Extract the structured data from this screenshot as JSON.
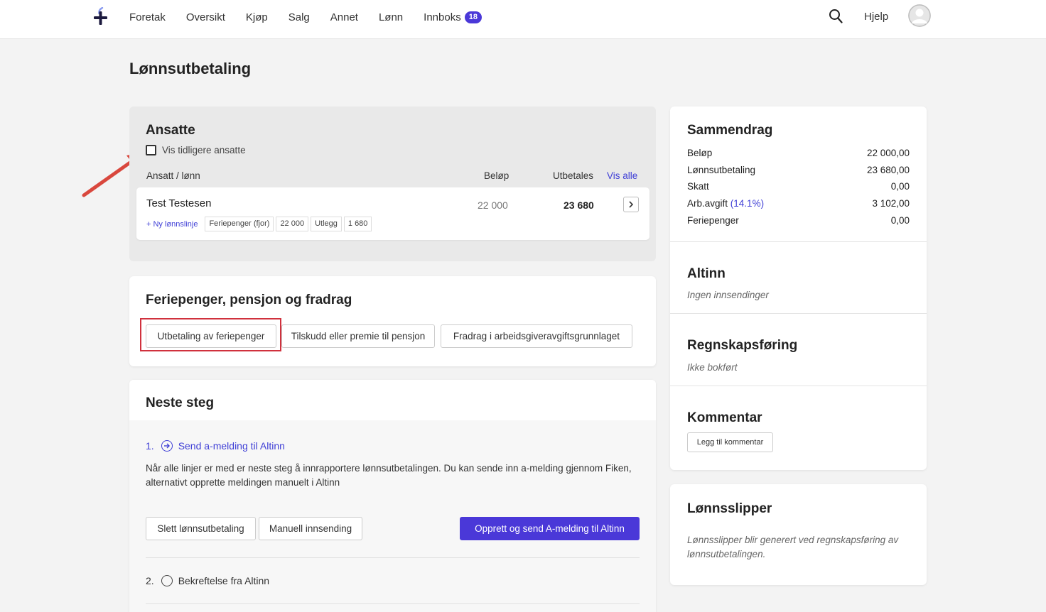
{
  "nav": {
    "items": [
      "Foretak",
      "Oversikt",
      "Kjøp",
      "Salg",
      "Annet",
      "Lønn",
      "Innboks"
    ],
    "inbox_badge": "18",
    "help": "Hjelp"
  },
  "page_title": "Lønnsutbetaling",
  "ansatte": {
    "title": "Ansatte",
    "checkbox_label": "Vis tidligere ansatte",
    "col_employee": "Ansatt / lønn",
    "col_amount": "Beløp",
    "col_paid": "Utbetales",
    "show_all": "Vis alle",
    "employee": {
      "name": "Test Testesen",
      "amount": "22 000",
      "paid": "23 680",
      "new_line": "+ Ny lønnslinje",
      "tags": [
        "Feriepenger (fjor)",
        "22 000",
        "Utlegg",
        "1 680"
      ]
    }
  },
  "ferie": {
    "title": "Feriepenger, pensjon og fradrag",
    "btn1": "Utbetaling av feriepenger",
    "btn2": "Tilskudd eller premie til pensjon",
    "btn3": "Fradrag i arbeidsgiveravgiftsgrunnlaget"
  },
  "neste": {
    "title": "Neste steg",
    "step1_num": "1.",
    "step1_label": "Send a-melding til Altinn",
    "step1_desc": "Når alle linjer er med er neste steg å innrapportere lønnsutbetalingen. Du kan sende inn a-melding gjennom Fiken, alternativt opprette meldingen manuelt i Altinn",
    "btn_delete": "Slett lønnsutbetaling",
    "btn_manual": "Manuell innsending",
    "btn_send": "Opprett og send A-melding til Altinn",
    "step2_num": "2.",
    "step2_label": "Bekreftelse fra Altinn"
  },
  "summary": {
    "title": "Sammendrag",
    "rows": [
      {
        "label": "Beløp",
        "value": "22 000,00"
      },
      {
        "label": "Lønnsutbetaling",
        "value": "23 680,00"
      },
      {
        "label": "Skatt",
        "value": "0,00"
      },
      {
        "label": "Arb.avgift",
        "value": "3 102,00"
      },
      {
        "label": "Feriepenger",
        "value": "0,00"
      }
    ],
    "arb_pct": "(14.1%)"
  },
  "altinn": {
    "title": "Altinn",
    "note": "Ingen innsendinger"
  },
  "regnskap": {
    "title": "Regnskapsføring",
    "note": "Ikke bokført"
  },
  "kommentar": {
    "title": "Kommentar",
    "btn": "Legg til kommentar"
  },
  "slipper": {
    "title": "Lønnsslipper",
    "note": "Lønnsslipper blir generert ved regnskapsføring av lønnsutbetalingen."
  },
  "colors": {
    "accent": "#4a38d8",
    "link": "#3f3fd6",
    "annotation": "#d0313d"
  }
}
